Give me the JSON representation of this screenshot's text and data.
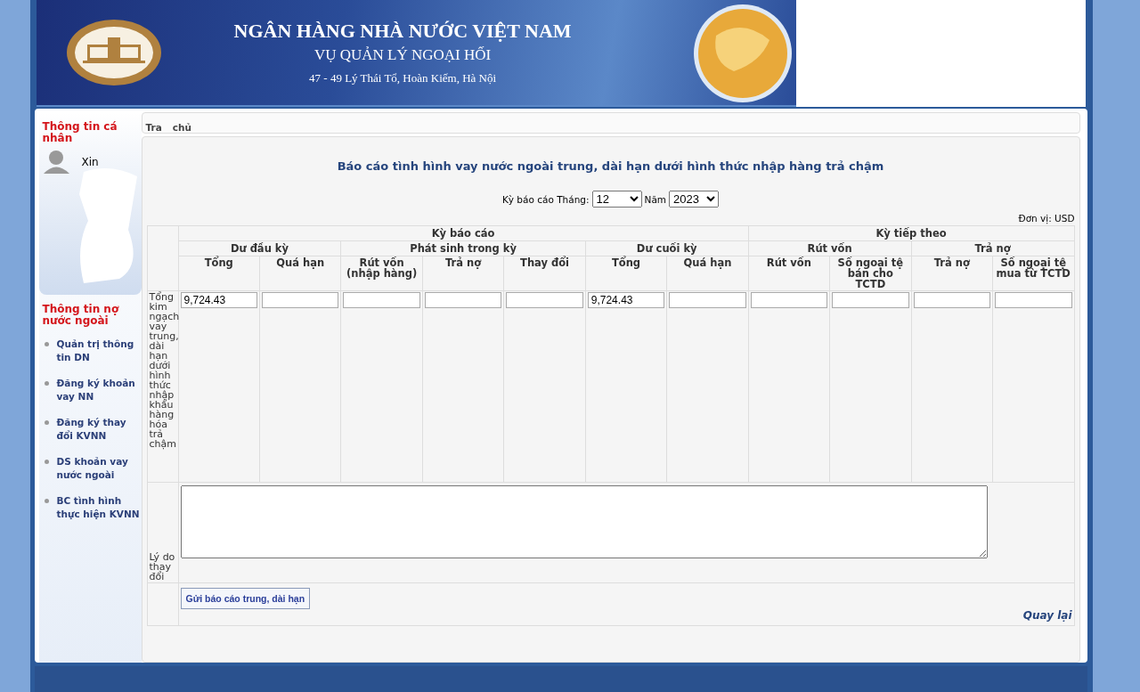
{
  "header": {
    "title": "NGÂN HÀNG NHÀ NƯỚC VIỆT NAM",
    "subtitle": "VỤ QUẢN LÝ NGOẠI HỐI",
    "address": "47 - 49 Lý Thái Tổ, Hoàn Kiếm, Hà Nội"
  },
  "sidebar": {
    "personal_heading": "Thông tin cá nhân",
    "greeting": "Xin",
    "debt_heading": "Thông tin nợ nước ngoài",
    "items": [
      {
        "label": "Quản trị thông tin DN"
      },
      {
        "label": "Đăng ký khoản vay NN"
      },
      {
        "label": "Đăng ký thay đổi KVNN"
      },
      {
        "label": "DS khoản vay nước ngoài"
      },
      {
        "label": "BC tình hình thực hiện KVNN"
      }
    ]
  },
  "breadcrumb": [
    "Tra",
    "chủ"
  ],
  "report": {
    "title": "Báo cáo tình hình vay nước ngoài trung, dài hạn dưới hình thức nhập hàng trả chậm",
    "period_label": "Kỳ báo cáo Tháng:",
    "month": "12",
    "year_label": "Năm",
    "year": "2023",
    "unit": "Đơn vị: USD",
    "header_row_1": [
      "Kỳ báo cáo",
      "Kỳ tiếp theo"
    ],
    "header_row_2": [
      "Dư đầu kỳ",
      "Phát sinh trong kỳ",
      "Dư cuối kỳ",
      "Rút vốn",
      "Trả nợ"
    ],
    "columns": [
      {
        "label": "Tổng",
        "value": "9,724.43"
      },
      {
        "label": "Quá hạn"
      },
      {
        "label": "Rút vốn (nhập hàng)"
      },
      {
        "label": "Trả nợ"
      },
      {
        "label": "Thay đổi"
      },
      {
        "label": "Tổng",
        "value": "9,724.43"
      },
      {
        "label": "Quá hạn"
      },
      {
        "label": "Rút vốn"
      },
      {
        "label": "Số ngoại tệ bán cho TCTD"
      },
      {
        "label": "Trả nợ"
      },
      {
        "label": "Số ngoại tệ mua từ TCTD"
      }
    ],
    "row_label": "Tổng kim ngạch vay trung, dài hạn dưới hình thức nhập khẩu hàng hóa trả chậm",
    "reason_label": "Lý do thay đổi",
    "submit_button": "Gửi báo cáo trung, dài hạn",
    "back_link": "Quay lại"
  }
}
